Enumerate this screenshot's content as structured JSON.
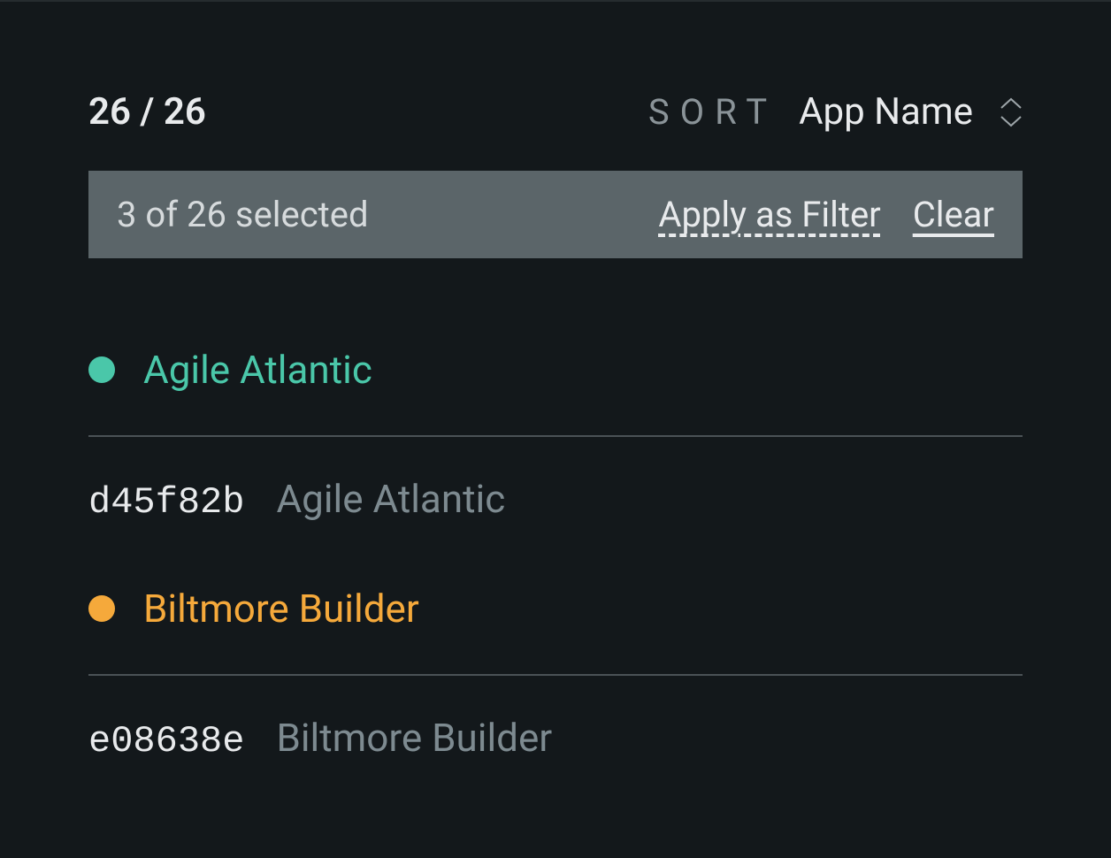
{
  "header": {
    "count": "26 / 26",
    "sort_label": "SORT",
    "sort_value": "App Name"
  },
  "selection": {
    "text": "3 of 26 selected",
    "apply_label": "Apply as Filter",
    "clear_label": "Clear"
  },
  "groups": [
    {
      "color": "teal",
      "title": "Agile Atlantic",
      "items": [
        {
          "id": "d45f82b",
          "name": "Agile Atlantic"
        }
      ]
    },
    {
      "color": "orange",
      "title": "Biltmore Builder",
      "items": [
        {
          "id": "e08638e",
          "name": "Biltmore Builder"
        }
      ]
    }
  ],
  "colors": {
    "background": "#13181b",
    "teal": "#4ac7a9",
    "orange": "#f5a93b",
    "selection_bar": "#5b6569",
    "text_primary": "#e8eaec",
    "text_muted": "#7d8a90"
  }
}
